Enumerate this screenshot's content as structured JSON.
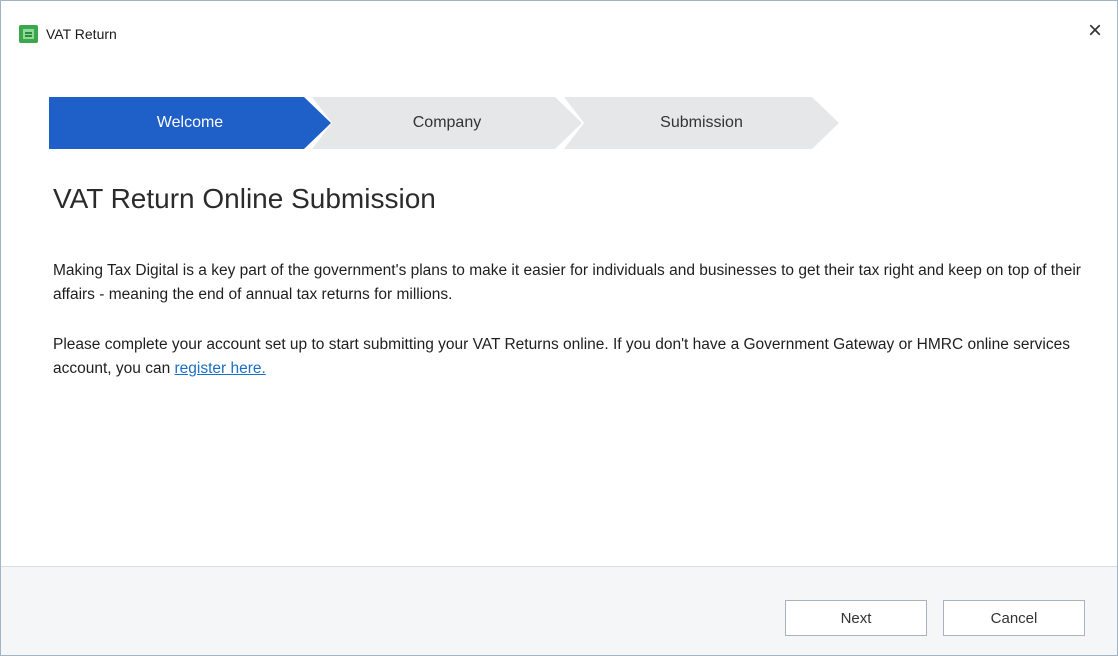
{
  "window": {
    "title": "VAT Return",
    "close_label": "×"
  },
  "steps": [
    {
      "label": "Welcome",
      "active": true
    },
    {
      "label": "Company",
      "active": false
    },
    {
      "label": "Submission",
      "active": false
    }
  ],
  "content": {
    "heading": "VAT Return Online Submission",
    "paragraph_1": "Making Tax Digital is a key part of the government's plans to make it easier for individuals and businesses to get their tax right and keep on top of their affairs - meaning the end of annual tax returns for millions.",
    "paragraph_2_text": "Please complete your account set up to start submitting your VAT Returns online. If you don't have a Government Gateway or HMRC online services account, you can ",
    "register_link": "register here."
  },
  "footer": {
    "next_label": "Next",
    "cancel_label": "Cancel"
  },
  "colors": {
    "active_step": "#1e5fc8",
    "inactive_step": "#e6e7e9",
    "link": "#1a6fc7",
    "app_icon": "#3aa84a"
  },
  "icons": {
    "app": "vat-return-app-icon",
    "close": "close-icon"
  }
}
